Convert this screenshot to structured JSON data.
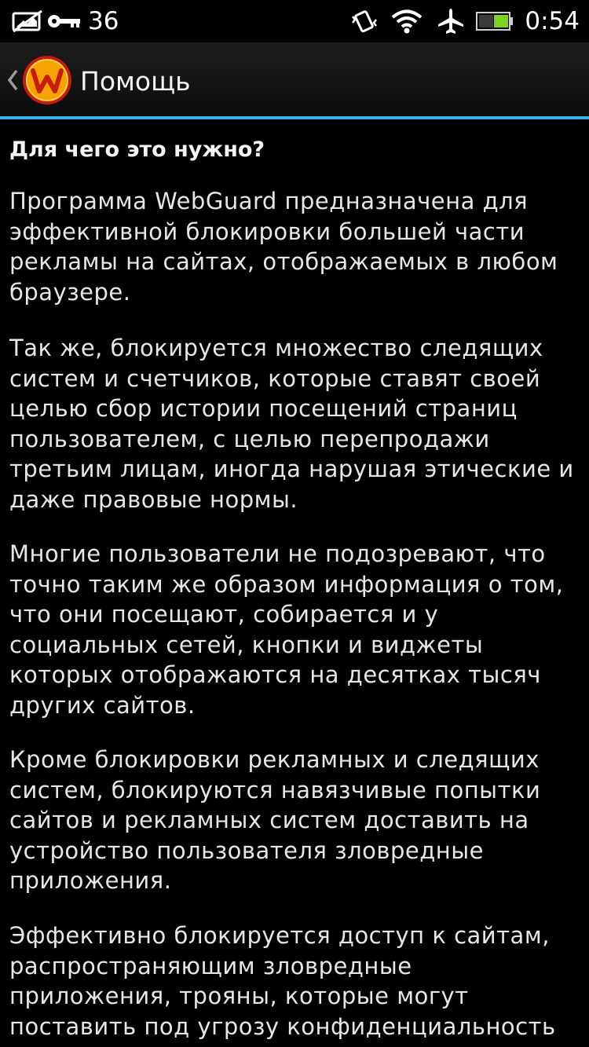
{
  "status_bar": {
    "notification_count": "36",
    "time": "0:54",
    "icons": [
      "image-notification-icon",
      "key-icon",
      "vibrate-icon",
      "wifi-icon",
      "airplane-mode-icon",
      "battery-icon"
    ]
  },
  "action_bar": {
    "title": "Помощь",
    "logo_letter": "W",
    "accent_color": "#33b5e5",
    "logo_color": "#f5a300"
  },
  "content": {
    "heading": "Для чего это нужно?",
    "paragraphs": [
      "Программа WebGuard предназначена для\nэффективной блокировки большей части\nрекламы на сайтах, отображаемых в любом\nбраузере.",
      "Так же, блокируется множество следящих\nсистем и счетчиков, которые ставят своей\nцелью сбор истории посещений страниц\nпользователем, с целью перепродажи\nтретьим лицам, иногда нарушая этические и\nдаже правовые нормы.",
      "Многие пользователи не подозревают, что\nточно таким же образом информация о том,\nчто они посещают, собирается и у\nсоциальных сетей, кнопки и виджеты\nкоторых отображаются на десятках тысяч\nдругих сайтов.",
      "Кроме блокировки рекламных и следящих\nсистем, блокируются навязчивые попытки\nсайтов и рекламных систем доставить на\nустройство пользователя зловредные\nприложения.",
      "Эффективно блокируется доступ к сайтам,\nраспространяющим зловредные\nприложения, трояны, которые могут\nпоставить под угрозу конфиденциальность"
    ]
  }
}
